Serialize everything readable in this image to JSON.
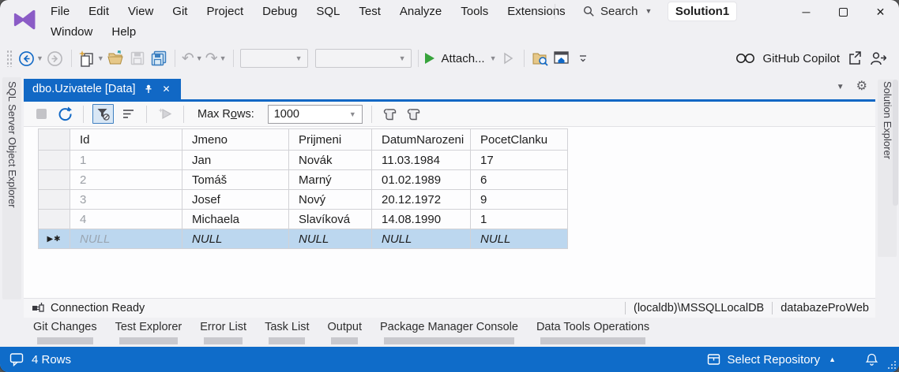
{
  "window": {
    "solution_badge": "Solution1",
    "controls": {
      "minimize": "─",
      "close": "✕"
    }
  },
  "menu": {
    "row1": [
      "File",
      "Edit",
      "View",
      "Git",
      "Project",
      "Debug",
      "SQL",
      "Test",
      "Analyze",
      "Tools",
      "Extensions"
    ],
    "row2": [
      "Window",
      "Help"
    ],
    "search_label": "Search"
  },
  "toolbar": {
    "attach_label": "Attach...",
    "copilot_label": "GitHub Copilot"
  },
  "editor": {
    "tab_title": "dbo.Uzivatele [Data]",
    "toolbar": {
      "max_rows_pre": "Max R",
      "max_rows_key": "o",
      "max_rows_post": "ws:",
      "max_rows_value": "1000"
    },
    "grid": {
      "columns": [
        "Id",
        "Jmeno",
        "Prijmeni",
        "DatumNarozeni",
        "PocetClanku"
      ],
      "rows": [
        [
          "1",
          "Jan",
          "Novák",
          "11.03.1984",
          "17"
        ],
        [
          "2",
          "Tomáš",
          "Marný",
          "01.02.1989",
          "6"
        ],
        [
          "3",
          "Josef",
          "Nový",
          "20.12.1972",
          "9"
        ],
        [
          "4",
          "Michaela",
          "Slavíková",
          "14.08.1990",
          "1"
        ]
      ],
      "new_row": {
        "marker": "▶✱",
        "cells": [
          "NULL",
          "NULL",
          "NULL",
          "NULL",
          "NULL"
        ]
      }
    },
    "statusbar": {
      "connection": "Connection Ready",
      "server": "(localdb)\\MSSQLLocalDB",
      "database": "databazeProWeb"
    }
  },
  "panels": {
    "left_title": "SQL Server Object Explorer",
    "right_title": "Solution Explorer"
  },
  "bottom_tabs": [
    "Git Changes",
    "Test Explorer",
    "Error List",
    "Task List",
    "Output",
    "Package Manager Console",
    "Data Tools Operations"
  ],
  "statusbar": {
    "rows_label": "4 Rows",
    "repository_label": "Select Repository"
  },
  "colors": {
    "accent_blue": "#1168C5",
    "statusbar_blue": "#0F6CC9",
    "new_row_highlight": "#BCD7EF",
    "vs_logo_purple": "#8B5CC6"
  }
}
